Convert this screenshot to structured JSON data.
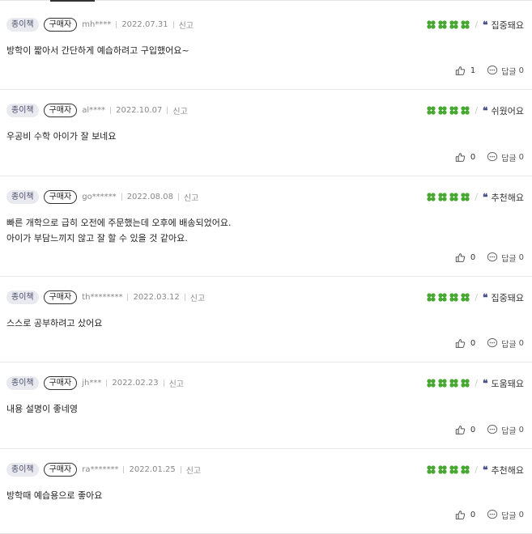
{
  "colors": {
    "clover": "#49a833",
    "quote": "#4a4f8a",
    "format_tag_bg": "#e9e9f0"
  },
  "icons": {
    "rating": "four-leaf-clover-icon",
    "keyword": "quote-icon",
    "like": "thumbs-up-icon",
    "comment": "speech-bubble-icon"
  },
  "reviews": [
    {
      "format": "종이책",
      "buyer": "구매자",
      "user": "mh****",
      "date": "2022.07.31",
      "report": "신고",
      "rating": 4,
      "keyword": "집중돼요",
      "lines": [
        "방학이 짧아서 간단하게 예습하려고 구입했어요~"
      ],
      "likes": "1",
      "comment_label": "답글",
      "comments": "0"
    },
    {
      "format": "종이책",
      "buyer": "구매자",
      "user": "al****",
      "date": "2022.10.07",
      "report": "신고",
      "rating": 4,
      "keyword": "쉬웠어요",
      "lines": [
        "우공비 수학 아이가 잘 보네요"
      ],
      "likes": "0",
      "comment_label": "답글",
      "comments": "0"
    },
    {
      "format": "종이책",
      "buyer": "구매자",
      "user": "go******",
      "date": "2022.08.08",
      "report": "신고",
      "rating": 4,
      "keyword": "추천해요",
      "lines": [
        "빠른 개학으로 급히 오전에 주문했는데 오후에 배송되었어요.",
        "아이가 부담느끼지 않고 잘 할 수 있을 것 같아요."
      ],
      "likes": "0",
      "comment_label": "답글",
      "comments": "0"
    },
    {
      "format": "종이책",
      "buyer": "구매자",
      "user": "th********",
      "date": "2022.03.12",
      "report": "신고",
      "rating": 4,
      "keyword": "집중돼요",
      "lines": [
        "스스로 공부하려고 샀어요"
      ],
      "likes": "0",
      "comment_label": "답글",
      "comments": "0"
    },
    {
      "format": "종이책",
      "buyer": "구매자",
      "user": "jh***",
      "date": "2022.02.23",
      "report": "신고",
      "rating": 4,
      "keyword": "도움돼요",
      "lines": [
        "내용 설명이 좋네영"
      ],
      "likes": "0",
      "comment_label": "답글",
      "comments": "0"
    },
    {
      "format": "종이책",
      "buyer": "구매자",
      "user": "ra*******",
      "date": "2022.01.25",
      "report": "신고",
      "rating": 4,
      "keyword": "추천해요",
      "lines": [
        "방학때 예습용으로 좋아요"
      ],
      "likes": "0",
      "comment_label": "답글",
      "comments": "0"
    }
  ]
}
